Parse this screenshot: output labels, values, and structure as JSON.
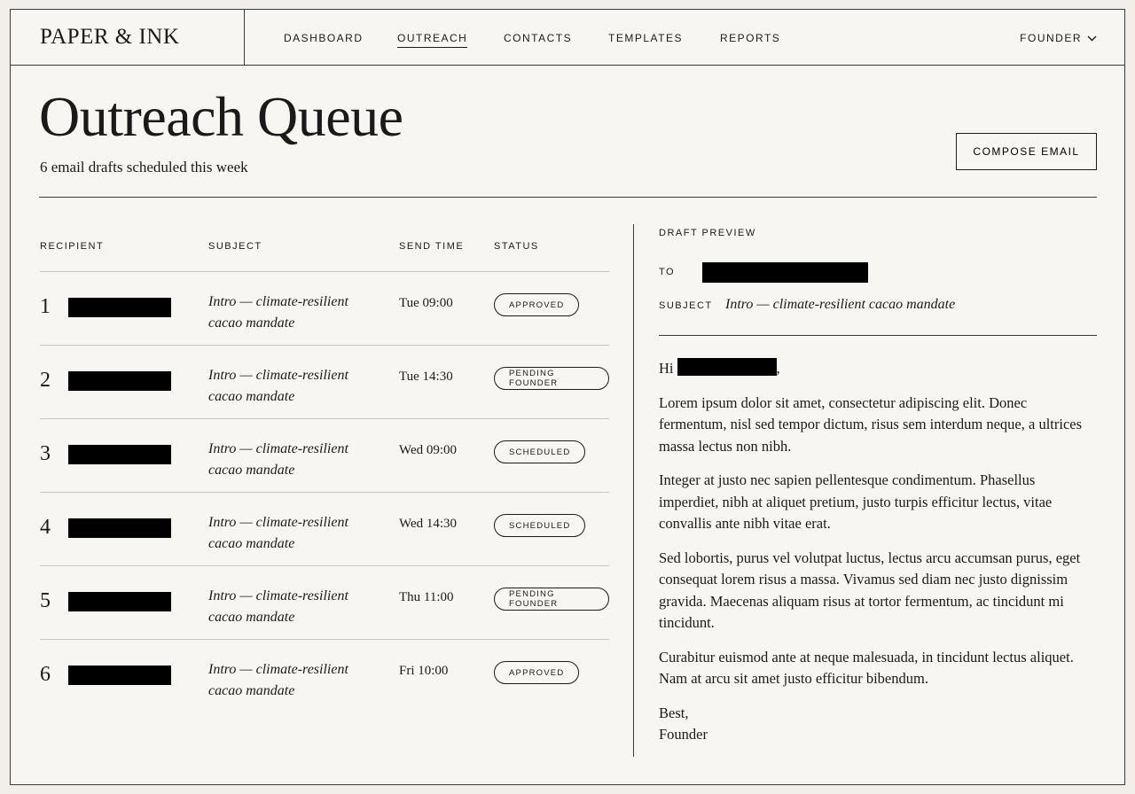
{
  "brand": "PAPER & INK",
  "nav": [
    "DASHBOARD",
    "OUTREACH",
    "CONTACTS",
    "TEMPLATES",
    "REPORTS"
  ],
  "nav_active": "OUTREACH",
  "user": "FOUNDER",
  "page": {
    "title": "Outreach Queue",
    "subtitle": "6 email drafts scheduled this week",
    "compose_label": "COMPOSE EMAIL"
  },
  "table": {
    "headers": [
      "RECIPIENT",
      "SUBJECT",
      "SEND TIME",
      "STATUS"
    ],
    "rows": [
      {
        "num": "1",
        "subject": "Intro — climate-resilient cacao mandate",
        "time": "Tue 09:00",
        "status": "APPROVED"
      },
      {
        "num": "2",
        "subject": "Intro — climate-resilient cacao mandate",
        "time": "Tue 14:30",
        "status": "PENDING FOUNDER"
      },
      {
        "num": "3",
        "subject": "Intro — climate-resilient cacao mandate",
        "time": "Wed 09:00",
        "status": "SCHEDULED"
      },
      {
        "num": "4",
        "subject": "Intro — climate-resilient cacao mandate",
        "time": "Wed 14:30",
        "status": "SCHEDULED"
      },
      {
        "num": "5",
        "subject": "Intro — climate-resilient cacao mandate",
        "time": "Thu 11:00",
        "status": "PENDING FOUNDER"
      },
      {
        "num": "6",
        "subject": "Intro — climate-resilient cacao mandate",
        "time": "Fri 10:00",
        "status": "APPROVED"
      }
    ]
  },
  "preview": {
    "label": "DRAFT PREVIEW",
    "to_label": "TO",
    "subject_label": "SUBJECT",
    "subject": "Intro — climate-resilient cacao mandate",
    "greeting": "Hi",
    "greeting_end": ",",
    "paragraphs": [
      "Lorem ipsum dolor sit amet, consectetur adipiscing elit. Donec fermentum, nisl sed tempor dictum, risus sem interdum neque, a ultrices massa lectus non nibh.",
      "Integer at justo nec sapien pellentesque condimentum. Phasellus imperdiet, nibh at aliquet pretium, justo turpis efficitur lectus, vitae convallis ante nibh vitae erat.",
      "Sed lobortis, purus vel volutpat luctus, lectus arcu accumsan purus, eget consequat lorem risus a massa. Vivamus sed diam nec justo dignissim gravida. Maecenas aliquam risus at tortor fermentum, ac tincidunt mi tincidunt.",
      "Curabitur euismod ante at neque malesuada, in tincidunt lectus aliquet. Nam at arcu sit amet justo efficitur bibendum."
    ],
    "signoff": "Best,",
    "signature": "Founder"
  }
}
